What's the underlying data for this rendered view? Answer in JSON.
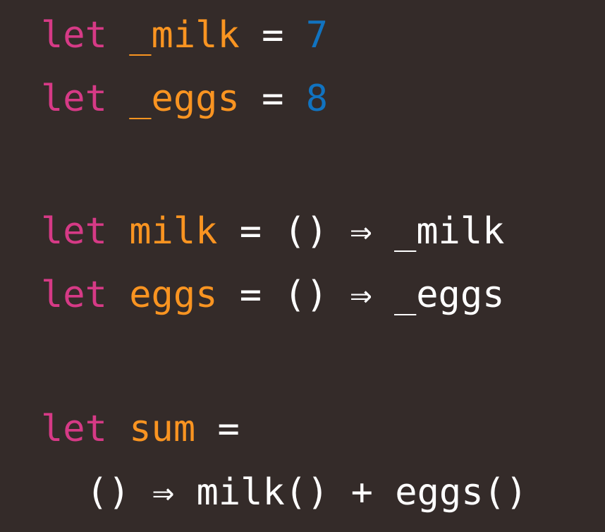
{
  "colors": {
    "background": "#342b29",
    "keyword": "#d63a86",
    "identifier": "#f99421",
    "number": "#1173c0",
    "text": "#ffffff"
  },
  "lines": [
    {
      "keyword": "let",
      "name": "_milk",
      "eq": "=",
      "value": "7"
    },
    {
      "keyword": "let",
      "name": "_eggs",
      "eq": "=",
      "value": "8"
    },
    {
      "keyword": "let",
      "name": "milk",
      "eq": "=",
      "rest": "() ⇒ _milk"
    },
    {
      "keyword": "let",
      "name": "eggs",
      "eq": "=",
      "rest": "() ⇒ _eggs"
    },
    {
      "keyword": "let",
      "name": "sum",
      "eq": "="
    },
    {
      "rest": "() ⇒ milk() + eggs()"
    }
  ]
}
